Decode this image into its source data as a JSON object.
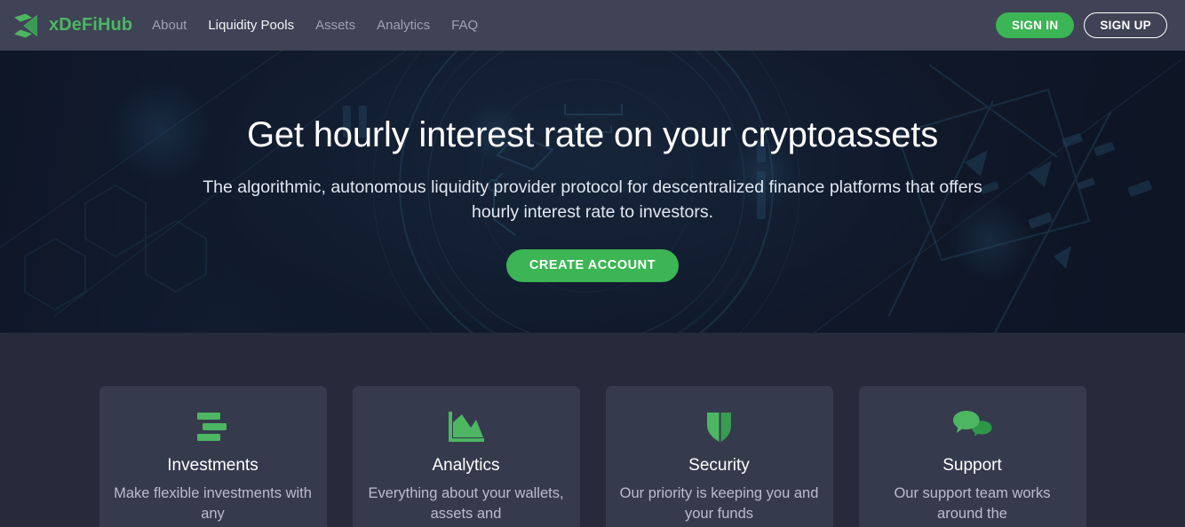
{
  "header": {
    "brand": {
      "name": "xDeFiHub",
      "logo_icon": "xdefihub-logo-icon",
      "accent_color": "#4cb663"
    },
    "nav": [
      {
        "label": "About",
        "active": false
      },
      {
        "label": "Liquidity Pools",
        "active": true
      },
      {
        "label": "Assets",
        "active": false
      },
      {
        "label": "Analytics",
        "active": false
      },
      {
        "label": "FAQ",
        "active": false
      }
    ],
    "sign_in_label": "SIGN IN",
    "sign_up_label": "SIGN UP",
    "sign_in_color": "#3cb554"
  },
  "hero": {
    "title": "Get hourly interest rate on your cryptoassets",
    "subtitle": "The algorithmic, autonomous liquidity provider protocol for descentralized finance platforms that offers hourly interest rate to investors.",
    "cta_label": "CREATE ACCOUNT",
    "cta_color": "#3cb554"
  },
  "features": {
    "cards": [
      {
        "icon": "bars-icon",
        "title": "Investments",
        "description": "Make flexible investments with any"
      },
      {
        "icon": "area-chart-icon",
        "title": "Analytics",
        "description": "Everything about your wallets, assets and"
      },
      {
        "icon": "shield-icon",
        "title": "Security",
        "description": "Our priority is keeping you and your funds"
      },
      {
        "icon": "chat-bubbles-icon",
        "title": "Support",
        "description": "Our support team works around the"
      }
    ],
    "icon_color": "#4cb663"
  }
}
